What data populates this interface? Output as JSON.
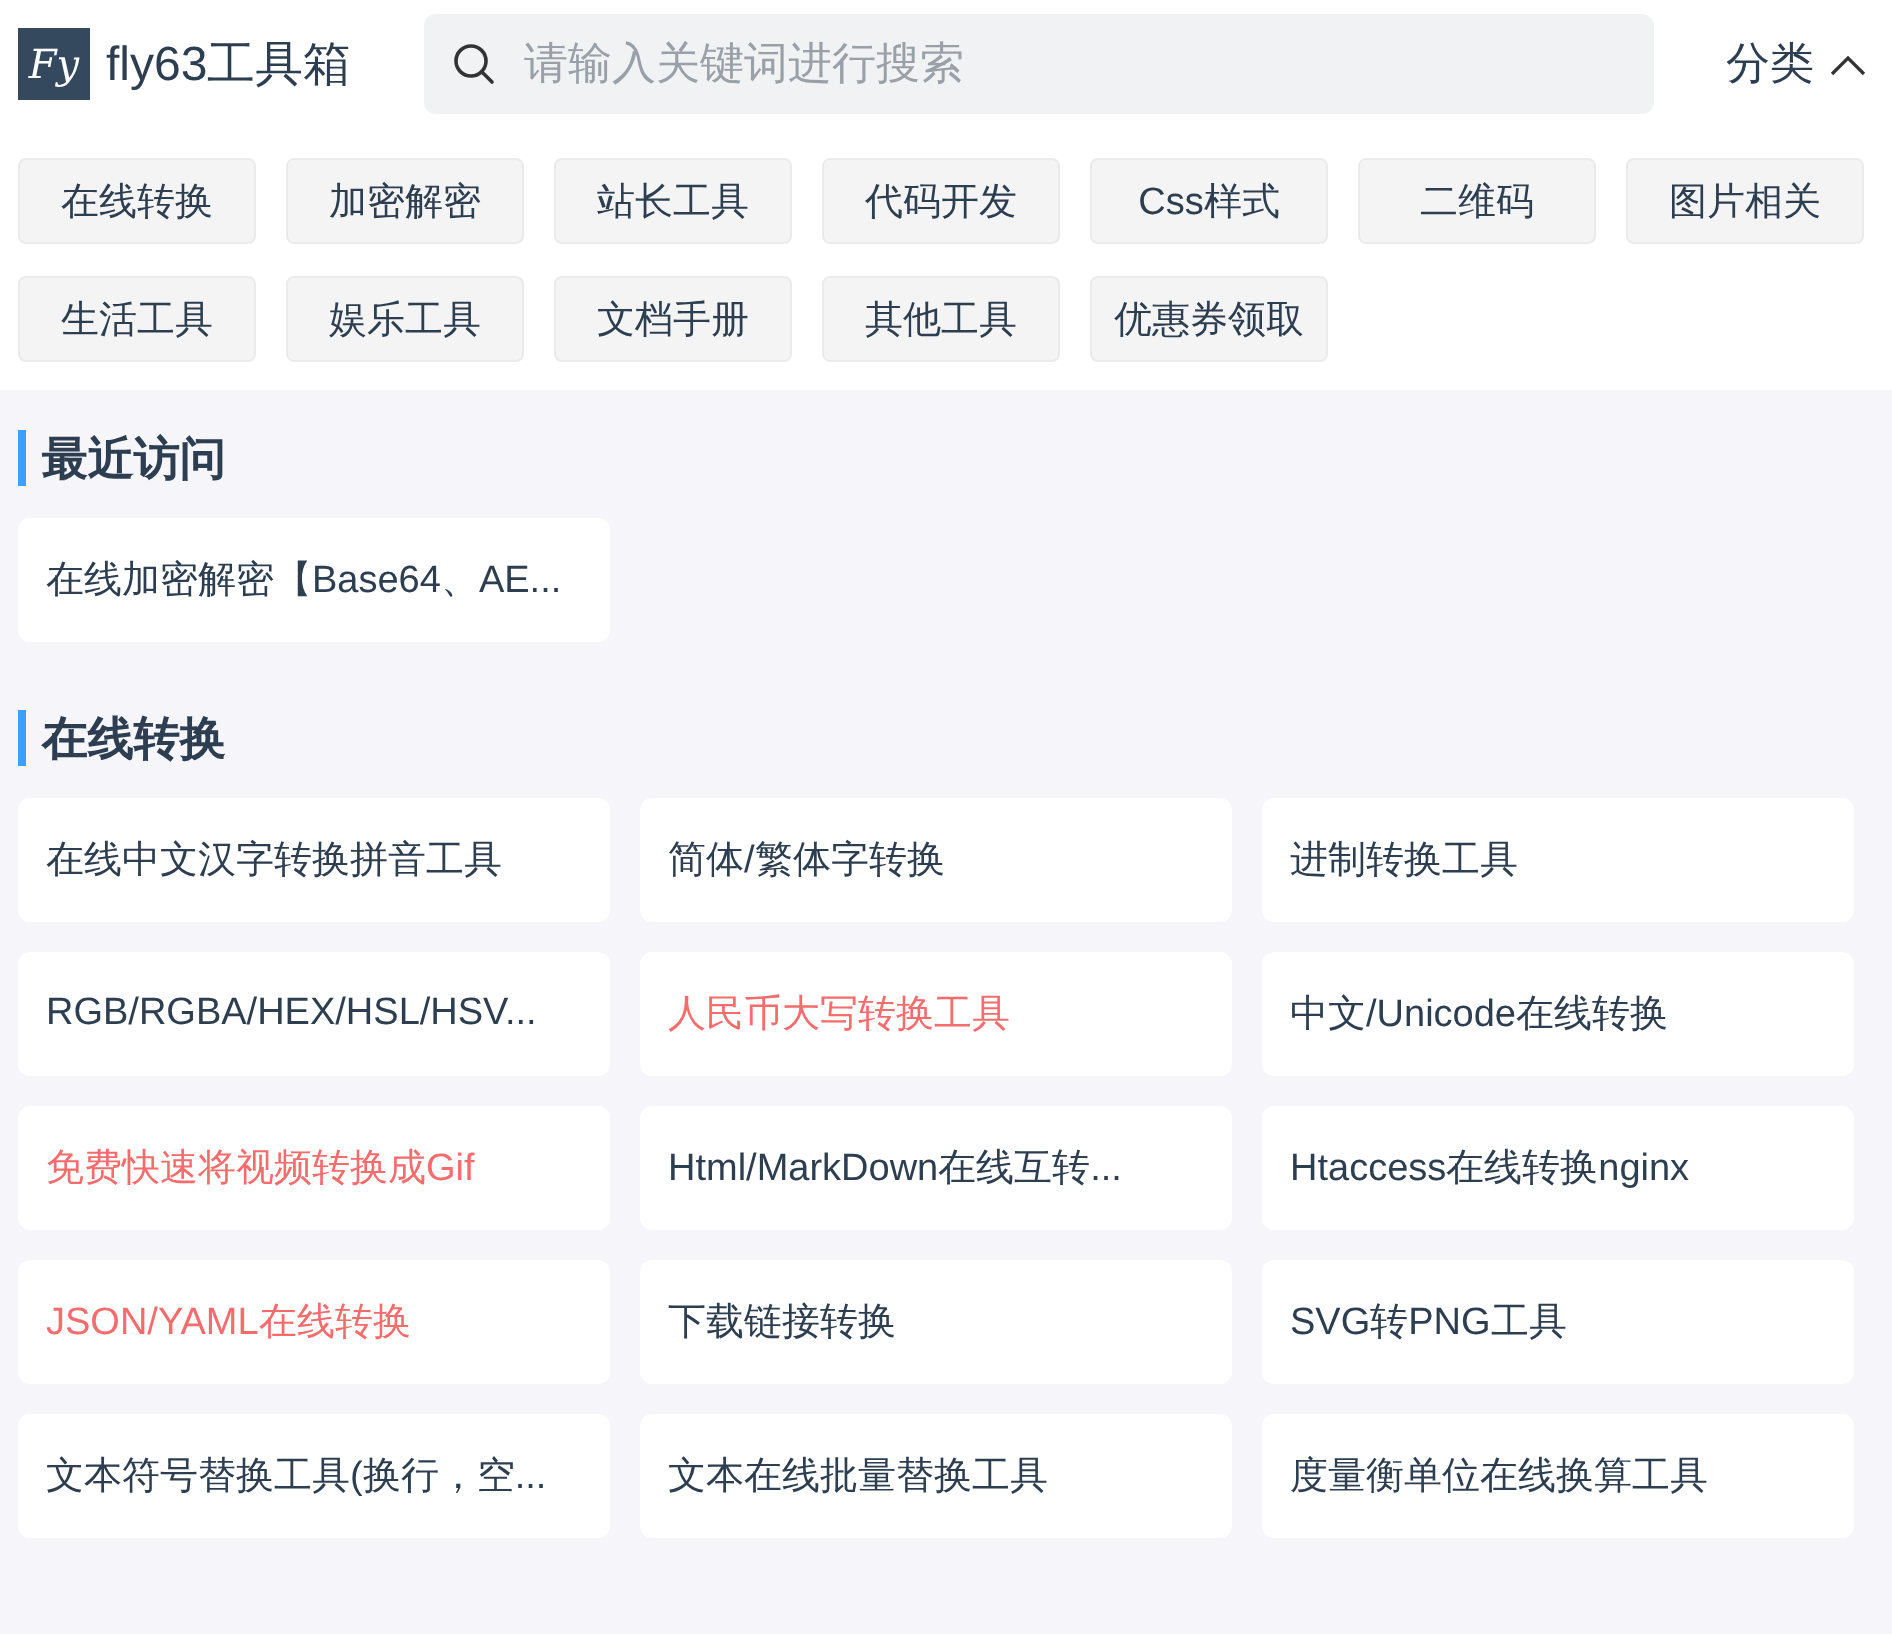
{
  "header": {
    "logo_text": "Fy",
    "site_name": "fly63工具箱",
    "search": {
      "placeholder": "请输入关键词进行搜索"
    },
    "category_toggle": {
      "label": "分类",
      "expanded": true
    }
  },
  "categories": [
    {
      "label": "在线转换"
    },
    {
      "label": "加密解密"
    },
    {
      "label": "站长工具"
    },
    {
      "label": "代码开发"
    },
    {
      "label": "Css样式"
    },
    {
      "label": "二维码"
    },
    {
      "label": "图片相关"
    },
    {
      "label": "生活工具"
    },
    {
      "label": "娱乐工具"
    },
    {
      "label": "文档手册"
    },
    {
      "label": "其他工具"
    },
    {
      "label": "优惠券领取"
    }
  ],
  "sections": [
    {
      "title": "最近访问",
      "tools": [
        {
          "name": "在线加密解密【Base64、AE...",
          "highlighted": false
        }
      ]
    },
    {
      "title": "在线转换",
      "tools": [
        {
          "name": "在线中文汉字转换拼音工具",
          "highlighted": false
        },
        {
          "name": "简体/繁体字转换",
          "highlighted": false
        },
        {
          "name": "进制转换工具",
          "highlighted": false
        },
        {
          "name": "RGB/RGBA/HEX/HSL/HSV...",
          "highlighted": false
        },
        {
          "name": "人民币大写转换工具",
          "highlighted": true
        },
        {
          "name": "中文/Unicode在线转换",
          "highlighted": false
        },
        {
          "name": "免费快速将视频转换成Gif",
          "highlighted": true
        },
        {
          "name": "Html/MarkDown在线互转...",
          "highlighted": false
        },
        {
          "name": "Htaccess在线转换nginx",
          "highlighted": false
        },
        {
          "name": "JSON/YAML在线转换",
          "highlighted": true
        },
        {
          "name": "下载链接转换",
          "highlighted": false
        },
        {
          "name": "SVG转PNG工具",
          "highlighted": false
        },
        {
          "name": "文本符号替换工具(换行，空...",
          "highlighted": false
        },
        {
          "name": "文本在线批量替换工具",
          "highlighted": false
        },
        {
          "name": "度量衡单位在线换算工具",
          "highlighted": false
        }
      ]
    }
  ]
}
